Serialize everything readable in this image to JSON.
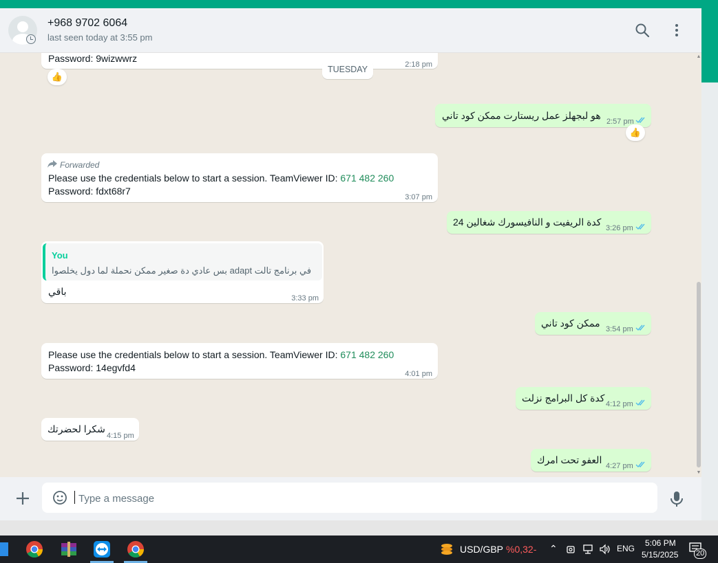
{
  "header": {
    "contact_name": "+968 9702 6064",
    "status": "last seen today at 3:55 pm",
    "search_icon": "search-icon",
    "menu_icon": "kebab-menu-icon"
  },
  "day_divider": "TUESDAY",
  "messages": [
    {
      "dir": "in",
      "text": "Password: 9wizwwrz",
      "time": "2:18 pm",
      "reaction": "👍"
    },
    {
      "dir": "out",
      "text": "هو لبجهلز عمل ريستارت ممكن كود تاني",
      "time": "2:57 pm",
      "reaction": "👍"
    },
    {
      "dir": "in",
      "forwarded_label": "Forwarded",
      "line1": "Please use the credentials below to start a session. TeamViewer ID: ",
      "id_link": "671 482 260",
      "line2": "Password: fdxt68r7",
      "time": "3:07 pm"
    },
    {
      "dir": "out",
      "text": "كدة الريفيت و النافيسورك شغالين 24",
      "time": "3:26 pm"
    },
    {
      "dir": "in",
      "quote_author": "You",
      "quote_text": "في برنامج تالت adapt بس عادي دة صغير ممكن نحملة لما دول يخلصوا",
      "text": "باقي",
      "time": "3:33 pm"
    },
    {
      "dir": "out",
      "text": "ممكن كود تاني",
      "time": "3:54 pm"
    },
    {
      "dir": "in",
      "line1": "Please use the credentials below to start a session. TeamViewer ID: ",
      "id_link": "671 482 260",
      "line2": "Password: 14egvfd4",
      "time": "4:01 pm"
    },
    {
      "dir": "out",
      "text": "كدة كل البرامج نزلت",
      "time": "4:12 pm"
    },
    {
      "dir": "in",
      "text": "شكرا لحضرتك",
      "time": "4:15 pm"
    },
    {
      "dir": "out",
      "text": "العفو تحت امرك",
      "time": "4:27 pm"
    }
  ],
  "composer": {
    "placeholder": "Type a message",
    "plus_icon": "plus-icon",
    "sticker_icon": "sticker-icon",
    "mic_icon": "mic-icon"
  },
  "taskbar": {
    "apps": [
      "chrome-icon",
      "winrar-icon",
      "teamviewer-icon",
      "chrome-icon"
    ],
    "ticker_label": "USD/GBP",
    "ticker_change": "%0,32-",
    "language": "ENG",
    "time": "5:06 PM",
    "date": "5/15/2025",
    "notification_count": "20"
  },
  "colors": {
    "accent": "#00a884",
    "outgoing_bubble": "#d9fdd3",
    "chat_bg": "#efeae2",
    "read_ticks": "#53bdeb",
    "negative": "#ff5c5c"
  }
}
